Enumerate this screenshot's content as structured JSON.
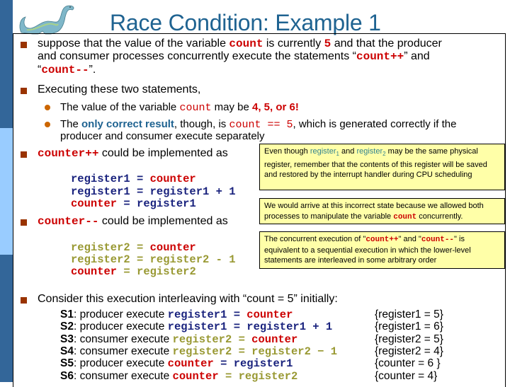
{
  "slide": {
    "title": "Race Condition: Example 1",
    "logo": "dinosaur-logo",
    "colors": {
      "title": "#1f6391",
      "sidebar_dark": "#336699",
      "sidebar_light": "#99ccff",
      "bullet_square": "#993300",
      "bullet_dot": "#cc6600",
      "code_red": "#cc0000",
      "code_blue": "#1a237e",
      "code_olive": "#999933",
      "note_bg": "#ffffa8"
    }
  },
  "bullets": {
    "b1": {
      "p1": "suppose that the value of the variable ",
      "code1": "count",
      "p2": " is currently ",
      "num": "5",
      "p3": " and that the producer",
      "line2": "and consumer processes concurrently execute the statements “",
      "code2": "count++",
      "p4": "” and",
      "open": "“",
      "code3": "count--",
      "close": "”."
    },
    "b2": {
      "text": "Executing these two statements,",
      "sub1": {
        "p1": "The value of the variable ",
        "code": "count",
        "p2": " may be ",
        "values": "4, 5, or 6!"
      },
      "sub2": {
        "p1": "The ",
        "emph": "only correct result",
        "p2": ", though, is ",
        "code": "count == 5",
        "p3": ", which is generated correctly if the",
        "line2": "producer and consumer execute separately"
      }
    },
    "b3": {
      "code": "counter++",
      "text": " could be implemented as",
      "lines": [
        [
          "register1",
          " = ",
          "counter"
        ],
        [
          "register1",
          " = ",
          "register1 + 1"
        ],
        [
          "counter",
          " = ",
          "register1"
        ]
      ]
    },
    "b4": {
      "code": "counter--",
      "text": " could be implemented as",
      "lines": [
        [
          "register2",
          " = ",
          "counter"
        ],
        [
          "register2",
          " = ",
          "register2 - 1"
        ],
        [
          "counter",
          " = ",
          "register2"
        ]
      ]
    },
    "b5": {
      "text": "Consider this execution interleaving with “count = 5” initially:",
      "steps": [
        {
          "label": "S1",
          "actor": ": producer execute ",
          "lhs": "register1",
          "eq": " = ",
          "rhs": "counter",
          "result": "{register1 = 5}"
        },
        {
          "label": "S2",
          "actor": ": producer execute ",
          "lhs": "register1",
          "eq": " = ",
          "rhs": "register1 + 1",
          "result": "{register1 = 6}"
        },
        {
          "label": "S3",
          "actor": ": consumer execute ",
          "lhs": "register2",
          "eq": " = ",
          "rhs": "counter",
          "result": "{register2 = 5}"
        },
        {
          "label": "S4",
          "actor": ": consumer execute ",
          "lhs": "register2",
          "eq": " = ",
          "rhs": "register2 − 1",
          "result": "{register2 = 4}"
        },
        {
          "label": "S5",
          "actor": ": producer execute ",
          "lhs": "counter",
          "eq": " = ",
          "rhs": "register1",
          "result": "{counter = 6 }"
        },
        {
          "label": "S6",
          "actor": ": consumer execute ",
          "lhs": "counter",
          "eq": " = ",
          "rhs": "register2",
          "result": "{counter = 4}"
        }
      ]
    }
  },
  "notes": {
    "n1": {
      "p1": "Even though ",
      "reg": "register",
      "sub1": "1",
      "p2": " and ",
      "sub2": "2",
      "p3": " may be the same physical register, remember that the contents of this register will be saved and restored by the interrupt handler during CPU scheduling"
    },
    "n2": {
      "p1": "We would arrive at this incorrect state because we allowed both processes to manipulate the variable ",
      "code": "count",
      "p2": " concurrently."
    },
    "n3": {
      "p1": "The concurrent execution of \"",
      "code1": "count++",
      "p2": "\" and \"",
      "code2": "count--",
      "p3": "\" is equivalent to a sequential execution in which the lower-level statements are interleaved in some arbitrary order"
    }
  }
}
